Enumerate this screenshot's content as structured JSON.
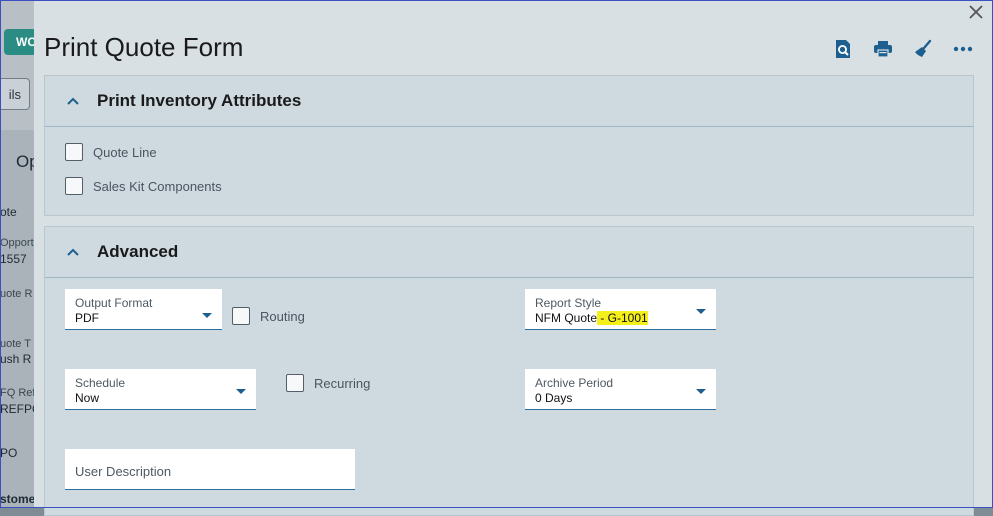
{
  "background": {
    "chip_label": "WO",
    "button_label": "ils",
    "section_label": "Op",
    "rows": [
      "ote",
      "Opportu",
      "1557",
      "uote R",
      "uote T",
      "ush R",
      "FQ Ref",
      "REFPO",
      "PO",
      "stome"
    ]
  },
  "dialog": {
    "title": "Print Quote Form",
    "toolbar": {
      "preview_icon": "preview-icon",
      "print_icon": "printer-icon",
      "clear_icon": "broom-icon",
      "more_icon": "more-icon"
    }
  },
  "sections": {
    "inventory": {
      "title": "Print Inventory Attributes",
      "checkboxes": [
        {
          "label": "Quote Line",
          "checked": false
        },
        {
          "label": "Sales Kit Components",
          "checked": false
        }
      ]
    },
    "advanced": {
      "title": "Advanced",
      "output_format": {
        "label": "Output Format",
        "value": "PDF"
      },
      "routing": {
        "label": "Routing",
        "checked": false
      },
      "report_style": {
        "label": "Report Style",
        "value_main": "NFM Quote",
        "value_highlight": " - G-1001"
      },
      "schedule": {
        "label": "Schedule",
        "value": "Now"
      },
      "recurring": {
        "label": "Recurring",
        "checked": false
      },
      "archive_period": {
        "label": "Archive Period",
        "value": "0 Days"
      },
      "user_description": {
        "placeholder": "User Description"
      }
    }
  },
  "colors": {
    "accent": "#1d5f8e",
    "highlight": "#f5ef1c"
  }
}
